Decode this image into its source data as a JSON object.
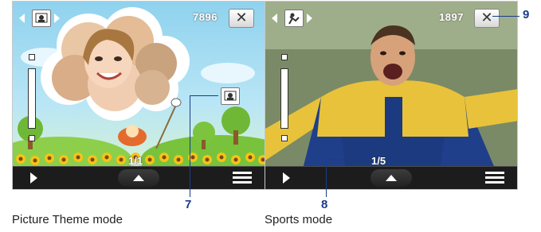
{
  "panels": [
    {
      "mode_caption": "Picture Theme mode",
      "counter": "7896",
      "close_glyph": "✕",
      "frame_count": "1/1",
      "mode_icon": "portrait-icon",
      "callout": "7"
    },
    {
      "mode_caption": "Sports mode",
      "counter": "1897",
      "close_glyph": "✕",
      "frame_count": "1/5",
      "mode_icon": "sports-mode-icon",
      "callouts": [
        "8",
        "9"
      ]
    }
  ],
  "colors": {
    "callout": "#1a3c8a",
    "bar": "#1c1c1c"
  }
}
